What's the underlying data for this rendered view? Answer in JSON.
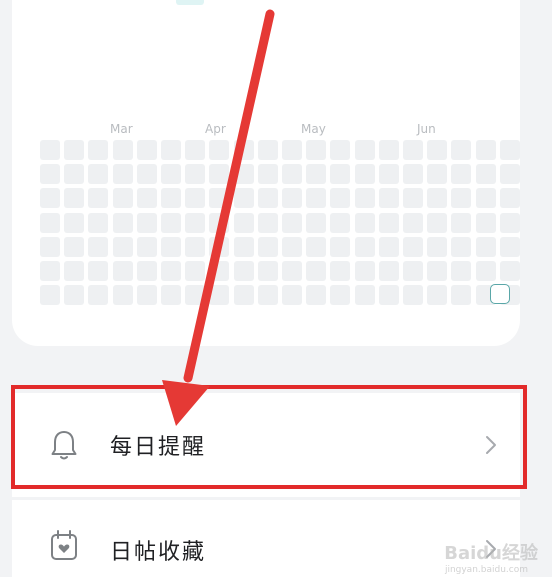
{
  "heatmap": {
    "months": [
      "Mar",
      "Apr",
      "May",
      "Jun"
    ],
    "active_days": 1
  },
  "menu": {
    "items": [
      {
        "label": "每日提醒",
        "icon": "bell-icon"
      },
      {
        "label": "日帖收藏",
        "icon": "calendar-heart-icon"
      }
    ]
  },
  "annotation": {
    "color": "#e22a2a",
    "highlighted_item": "每日提醒"
  },
  "watermark": {
    "text": "Baidu经验",
    "subtext": "jingyan.baidu.com"
  },
  "colors": {
    "background": "#f2f3f5",
    "card": "#ffffff",
    "heat_empty": "#eef0f2",
    "heat_active_border": "#5aa7a8"
  }
}
